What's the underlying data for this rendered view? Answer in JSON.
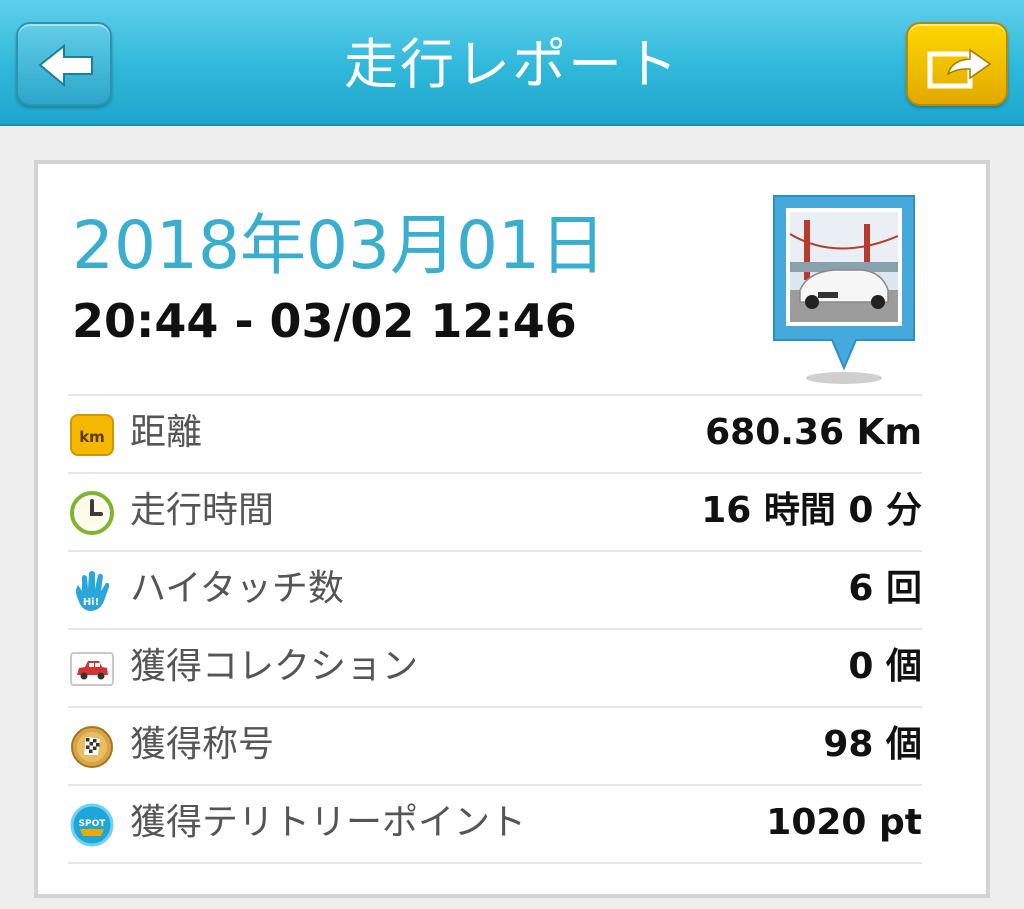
{
  "header": {
    "title": "走行レポート",
    "back_icon": "back-arrow-icon",
    "share_icon": "share-icon",
    "accent_color": "#2fb8da",
    "share_color": "#f2c200"
  },
  "report": {
    "date": "2018年03月01日",
    "time_range": "20:44 - 03/02 12:46",
    "thumbnail_icon": "car-photo-pin-icon"
  },
  "stats": [
    {
      "icon": "km-icon",
      "label": "距離",
      "value": "680.36 Km"
    },
    {
      "icon": "clock-icon",
      "label": "走行時間",
      "value": "16 時間 0 分"
    },
    {
      "icon": "hand-hi-icon",
      "label": "ハイタッチ数",
      "value": "6 回"
    },
    {
      "icon": "car-collection-icon",
      "label": "獲得コレクション",
      "value": "0 個"
    },
    {
      "icon": "flag-medal-icon",
      "label": "獲得称号",
      "value": "98 個"
    },
    {
      "icon": "spot-icon",
      "label": "獲得テリトリーポイント",
      "value": "1020 pt"
    }
  ],
  "icon_text": {
    "km": "km",
    "hi": "Hi!",
    "spot": "SPOT"
  }
}
